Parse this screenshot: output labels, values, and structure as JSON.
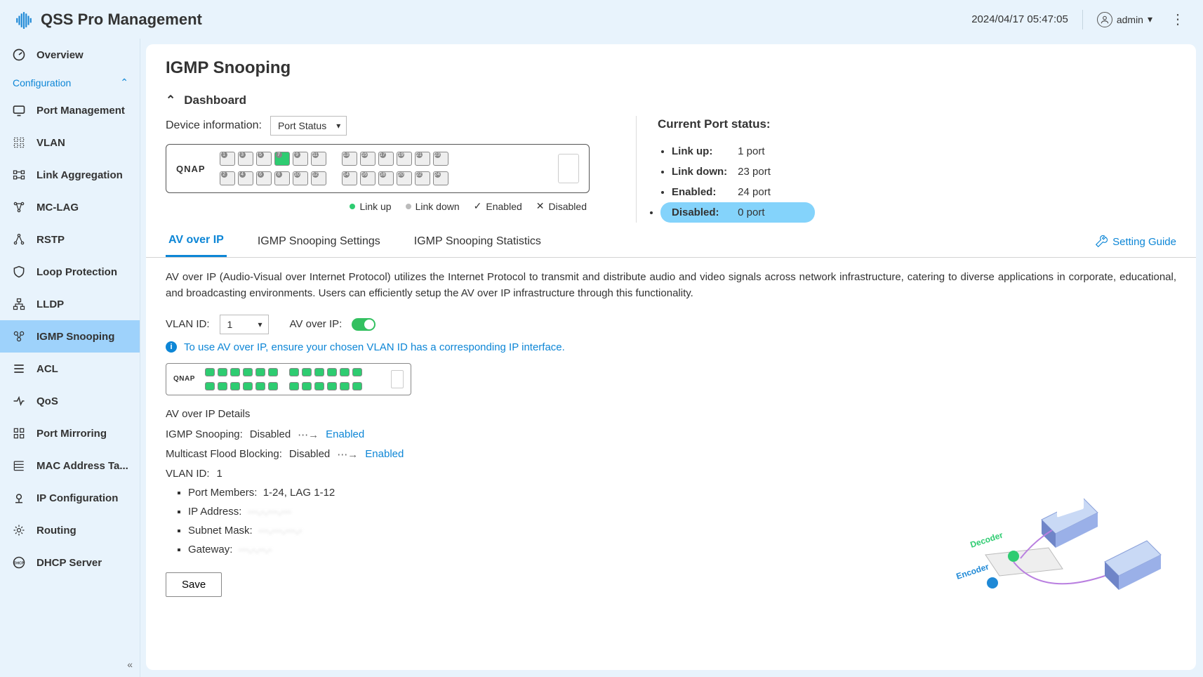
{
  "app_title": "QSS Pro Management",
  "datetime": "2024/04/17 05:47:05",
  "username": "admin",
  "sidebar": {
    "overview": "Overview",
    "config_section": "Configuration",
    "items": [
      "Port Management",
      "VLAN",
      "Link Aggregation",
      "MC-LAG",
      "RSTP",
      "Loop Protection",
      "LLDP",
      "IGMP Snooping",
      "ACL",
      "QoS",
      "Port Mirroring",
      "MAC Address Ta...",
      "IP Configuration",
      "Routing",
      "DHCP Server"
    ],
    "active_index": 7
  },
  "page": {
    "title": "IGMP Snooping",
    "dashboard_label": "Dashboard",
    "device_info_label": "Device information:",
    "device_info_select": "Port Status",
    "switch_brand": "QNAP",
    "legend": {
      "link_up": "Link up",
      "link_down": "Link down",
      "enabled": "Enabled",
      "disabled": "Disabled"
    },
    "port_status": {
      "title": "Current Port status:",
      "link_up_label": "Link up:",
      "link_up_value": "1 port",
      "link_down_label": "Link down:",
      "link_down_value": "23 port",
      "enabled_label": "Enabled:",
      "enabled_value": "24 port",
      "disabled_label": "Disabled:",
      "disabled_value": "0 port"
    },
    "tabs": [
      "AV over IP",
      "IGMP Snooping Settings",
      "IGMP Snooping Statistics"
    ],
    "active_tab": 0,
    "setting_guide": "Setting Guide",
    "description": "AV over IP (Audio-Visual over Internet Protocol) utilizes the Internet Protocol to transmit and distribute audio and video signals across network infrastructure, catering to diverse applications in corporate, educational, and broadcasting environments. Users can efficiently setup the AV over IP infrastructure through this functionality.",
    "vlan_id_label": "VLAN ID:",
    "vlan_id_value": "1",
    "av_over_ip_label": "AV over IP:",
    "info_text": "To use AV over IP, ensure your chosen VLAN ID has a corresponding IP interface.",
    "details": {
      "title": "AV over IP Details",
      "igmp_label": "IGMP Snooping:",
      "igmp_current": "Disabled",
      "igmp_target": "Enabled",
      "mfb_label": "Multicast Flood Blocking:",
      "mfb_current": "Disabled",
      "mfb_target": "Enabled",
      "vlan_label": "VLAN ID:",
      "vlan_value": "1",
      "port_members_label": "Port Members:",
      "port_members_value": "1-24, LAG 1-12",
      "ip_address_label": "IP Address:",
      "ip_address_value": "···.·.···.···",
      "subnet_label": "Subnet Mask:",
      "subnet_value": "···.···.···.·",
      "gateway_label": "Gateway:",
      "gateway_value": "···.·.··.·"
    },
    "save_label": "Save",
    "illustration_labels": {
      "decoder": "Decoder",
      "encoder": "Encoder"
    }
  }
}
